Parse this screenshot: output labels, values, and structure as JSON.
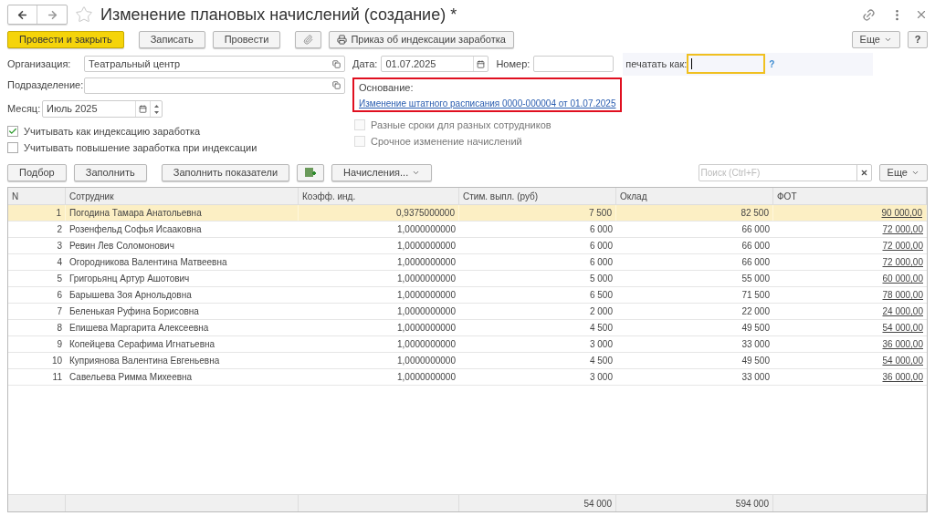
{
  "window": {
    "title": "Изменение плановых начислений (создание) *",
    "favorite": false
  },
  "toolbar": {
    "buttons": [
      {
        "kind": "primary",
        "label": "Провести и закрыть"
      },
      {
        "kind": "plain",
        "label": "Записать"
      },
      {
        "kind": "plain",
        "label": "Провести"
      },
      {
        "kind": "attach"
      },
      {
        "kind": "print",
        "label": "Приказ об индексации заработка"
      }
    ],
    "more": "Еще",
    "help": "?"
  },
  "form": {
    "organization": {
      "label": "Организация:",
      "value": "Театральный центр"
    },
    "department": {
      "label": "Подразделение:"
    },
    "month": {
      "label": "Месяц:",
      "value": "Июль 2025"
    },
    "date": {
      "label": "Дата:",
      "value": "01.07.2025"
    },
    "number": {
      "label": "Номер:"
    },
    "print_as": {
      "label": "печатать как:",
      "hint": "?"
    },
    "basis": {
      "label": "Основание:",
      "link": "Изменение штатного расписания 0000-000004 от 01.07.2025"
    },
    "left_checks": [
      {
        "label": "Учитывать как индексацию заработка",
        "checked": true,
        "disabled": false
      },
      {
        "label": "Учитывать повышение заработка при индексации",
        "checked": false,
        "disabled": false
      }
    ],
    "right_checks": [
      {
        "label": "Разные сроки для разных сотрудников",
        "checked": false,
        "disabled": true
      },
      {
        "label": "Срочное изменение начислений",
        "checked": false,
        "disabled": true
      }
    ]
  },
  "table_toolbar": {
    "buttons": [
      {
        "kind": "plain",
        "label": "Подбор"
      },
      {
        "kind": "plain",
        "label": "Заполнить"
      },
      {
        "kind": "plain",
        "label": "Заполнить показатели"
      },
      {
        "kind": "add-column"
      },
      {
        "kind": "menu",
        "label": "Начисления..."
      }
    ],
    "search_placeholder": "Поиск (Ctrl+F)",
    "more": "Еще"
  },
  "table": {
    "columns": [
      "N",
      "Сотрудник",
      "Коэфф. инд.",
      "Стим. выпл. (руб)",
      "Оклад",
      "ФОТ"
    ],
    "rows": [
      {
        "n": "1",
        "employee": "Погодина Тамара Анатольевна",
        "coef": "0,9375000000",
        "bonus": "7 500",
        "salary": "82 500",
        "fot": "90 000,00",
        "selected": true
      },
      {
        "n": "2",
        "employee": "Розенфельд Софья Исааковна",
        "coef": "1,0000000000",
        "bonus": "6 000",
        "salary": "66 000",
        "fot": "72 000,00",
        "selected": false
      },
      {
        "n": "3",
        "employee": "Ревин Лев Соломонович",
        "coef": "1,0000000000",
        "bonus": "6 000",
        "salary": "66 000",
        "fot": "72 000,00",
        "selected": false
      },
      {
        "n": "4",
        "employee": "Огородникова Валентина Матвеевна",
        "coef": "1,0000000000",
        "bonus": "6 000",
        "salary": "66 000",
        "fot": "72 000,00",
        "selected": false
      },
      {
        "n": "5",
        "employee": "Григорьянц Артур Ашотович",
        "coef": "1,0000000000",
        "bonus": "5 000",
        "salary": "55 000",
        "fot": "60 000,00",
        "selected": false
      },
      {
        "n": "6",
        "employee": "Барышева Зоя Арнольдовна",
        "coef": "1,0000000000",
        "bonus": "6 500",
        "salary": "71 500",
        "fot": "78 000,00",
        "selected": false
      },
      {
        "n": "7",
        "employee": "Беленькая Руфина Борисовна",
        "coef": "1,0000000000",
        "bonus": "2 000",
        "salary": "22 000",
        "fot": "24 000,00",
        "selected": false
      },
      {
        "n": "8",
        "employee": "Епишева Маргарита Алексеевна",
        "coef": "1,0000000000",
        "bonus": "4 500",
        "salary": "49 500",
        "fot": "54 000,00",
        "selected": false
      },
      {
        "n": "9",
        "employee": "Копейцева Серафима Игнатьевна",
        "coef": "1,0000000000",
        "bonus": "3 000",
        "salary": "33 000",
        "fot": "36 000,00",
        "selected": false
      },
      {
        "n": "10",
        "employee": "Куприянова Валентина Евгеньевна",
        "coef": "1,0000000000",
        "bonus": "4 500",
        "salary": "49 500",
        "fot": "54 000,00",
        "selected": false
      },
      {
        "n": "11",
        "employee": "Савельева Римма Михеевна",
        "coef": "1,0000000000",
        "bonus": "3 000",
        "salary": "33 000",
        "fot": "36 000,00",
        "selected": false
      }
    ],
    "totals": {
      "bonus": "54 000",
      "salary": "594 000"
    }
  }
}
